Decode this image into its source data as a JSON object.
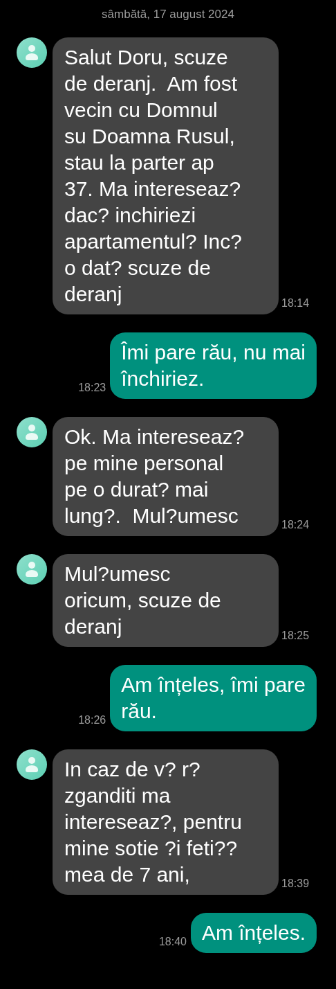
{
  "date_header": "sâmbătă, 17 august 2024",
  "messages": [
    {
      "kind": "incoming",
      "text": "Salut Doru, scuze\nde deranj.  Am fost\nvecin cu Domnul\nsu Doamna Rusul,\nstau la parter ap\n37. Ma intereseaz?\ndac? inchiriezi\napartamentul? Inc?\no dat? scuze de\nderanj",
      "time": "18:14"
    },
    {
      "kind": "outgoing",
      "text": "Îmi pare rău, nu mai\nînchiriez.",
      "time": "18:23"
    },
    {
      "kind": "incoming",
      "text": "Ok. Ma intereseaz?\npe mine personal\npe o durat? mai\nlung?.  Mul?umesc",
      "time": "18:24"
    },
    {
      "kind": "incoming",
      "text": "Mul?umesc\noricum, scuze de\nderanj",
      "time": "18:25"
    },
    {
      "kind": "outgoing",
      "text": "Am înțeles, îmi pare\nrău.",
      "time": "18:26"
    },
    {
      "kind": "incoming",
      "text": "In caz de v? r?\nzganditi ma\nintereseaz?, pentru\nmine sotie ?i feti??\nmea de 7 ani,",
      "time": "18:39"
    },
    {
      "kind": "outgoing",
      "text": "Am înțeles.",
      "time": "18:40"
    }
  ]
}
